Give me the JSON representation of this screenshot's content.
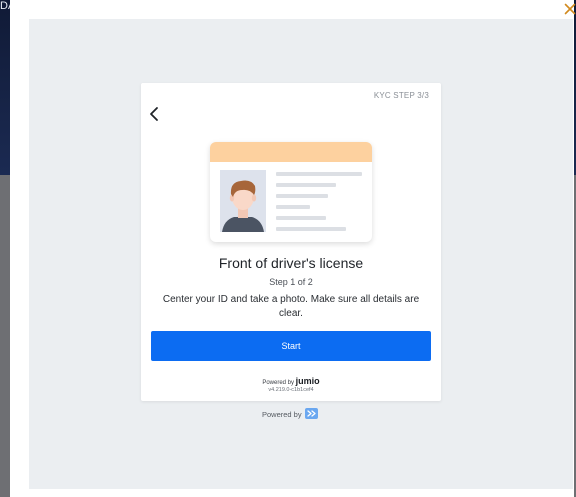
{
  "background": {
    "fragment_text": "DA"
  },
  "modal": {
    "close_icon": "close-icon",
    "accent_color": "#d18a1f"
  },
  "card": {
    "step_tag": "KYC STEP 3/3",
    "back_icon": "chevron-left-icon",
    "illustration_icon": "id-card-icon",
    "title": "Front of driver's license",
    "substep": "Step 1 of 2",
    "description": "Center your ID and take a photo. Make sure all details are clear.",
    "start_label": "Start",
    "start_color": "#0c6cf2",
    "powered_prefix": "Powered by",
    "powered_brand": "jumio",
    "version": "v4.219.0-c1b1cef4"
  },
  "footer": {
    "powered_label": "Powered by",
    "logo_icon": "provider-logo-icon"
  }
}
